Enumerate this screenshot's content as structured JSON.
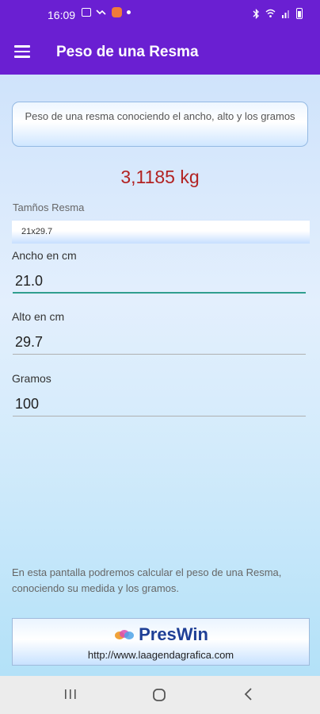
{
  "status": {
    "time": "16:09",
    "left_icons": [
      "gallery-icon",
      "missed-call-icon",
      "app-notification-icon",
      "dot-icon"
    ],
    "right_icons": [
      "bluetooth-icon",
      "wifi-icon",
      "signal-icon",
      "battery-icon"
    ]
  },
  "app_bar": {
    "title": "Peso de una Resma",
    "menu_icon": "hamburger-menu-icon"
  },
  "description": "Peso de una resma conociendo el ancho, alto y los gramos",
  "result": "3,1185 kg",
  "size_select": {
    "label": "Tamños Resma",
    "value": "21x29.7"
  },
  "fields": {
    "width": {
      "label": "Ancho en cm",
      "value": "21.0"
    },
    "height": {
      "label": "Alto en cm",
      "value": "29.7"
    },
    "grams": {
      "label": "Gramos",
      "value": "100"
    }
  },
  "footer_text": "En esta pantalla podremos calcular el peso de una Resma, conociendo su medida y los gramos.",
  "banner": {
    "logo_name": "PresWin",
    "url": "http://www.laagendagrafica.com"
  },
  "nav": {
    "recent_icon": "recent-apps-icon",
    "home_icon": "home-icon",
    "back_icon": "back-icon"
  },
  "colors": {
    "app_bar": "#6a1fd2",
    "result": "#b22222",
    "focus_underline": "#2f9e8f",
    "logo_text": "#1f3f96"
  }
}
